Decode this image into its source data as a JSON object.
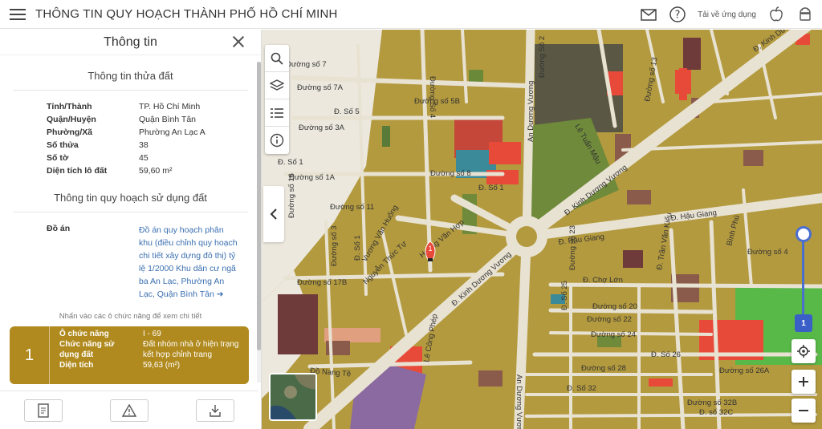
{
  "header": {
    "title": "THÔNG TIN QUY HOẠCH THÀNH PHỐ HỒ CHÍ MINH",
    "download_label": "Tải về ứng dụng"
  },
  "panel": {
    "title": "Thông tin",
    "parcel_section_title": "Thông tin thửa đất",
    "parcel": [
      {
        "key": "Tỉnh/Thành",
        "value": "TP. Hồ Chí Minh"
      },
      {
        "key": "Quận/Huyện",
        "value": "Quận Bình Tân"
      },
      {
        "key": "Phường/Xã",
        "value": "Phường An Lạc A"
      },
      {
        "key": "Số thửa",
        "value": "38"
      },
      {
        "key": "Số tờ",
        "value": "45"
      },
      {
        "key": "Diện tích lô đất",
        "value": "59,60 m²"
      }
    ],
    "plan_section_title": "Thông tin quy hoạch sử dụng đất",
    "plan_key": "Đồ án",
    "plan_link": "Đồ án quy hoạch phân khu (điều chỉnh quy hoạch chi tiết xây dựng đô thị) tỷ lệ 1/2000 Khu dân cư ngã ba An Lạc, Phường An Lạc, Quận Bình Tân ➔",
    "hint": "Nhấn vào các ô chức năng để xem chi tiết",
    "zone": {
      "number": "1",
      "rows": [
        {
          "key": "Ô chức năng",
          "value": "I - 69"
        },
        {
          "key": "Chức năng sử",
          "value": "Đất nhóm nhà ở hiện trạng"
        },
        {
          "key": "dụng đất",
          "value": "kết hợp chỉnh trang"
        },
        {
          "key": "Diện tích",
          "value": "59,63 (m²)"
        }
      ]
    }
  },
  "map": {
    "layer_badge": "1",
    "marker_number": "1",
    "streets": [
      "Đường số 7",
      "Đường số 7A",
      "Đ. Số 5",
      "Đường số 3A",
      "Đ. Số 1",
      "Đường số 1A",
      "Đường số 11",
      "Đường số 16",
      "Đường số 3",
      "Đường số 17B",
      "Đ. Số 1",
      "Đường số 5B",
      "Đường Số 4",
      "Đ. Số 1",
      "Nguyễn Thức Tự",
      "Vương Văn Huống",
      "Hoàng Văn Hợp",
      "Đ. Kinh Dương Vương",
      "An Dương Vương",
      "Lê Tuấn Mậu",
      "Đ. Kinh Dương Vương",
      "Đ. Hậu Giang",
      "Đ. Hậu Giang",
      "Đ. Chợ Lớn",
      "Đường số 20",
      "Đường số 22",
      "Đường số 24",
      "Đ. Số 26",
      "Đường số 28",
      "Đ. Số 32",
      "Đường số 26A",
      "Đ. Trần Văn Kiểu",
      "Bình Phú",
      "Đường số 4",
      "Đ. Kinh Dư",
      "Đồ Nang Tề",
      "Lê Công Phép",
      "An Dương Vương",
      "Đường số 23",
      "Đ. Số 25",
      "Đường số 32B",
      "Đ. số 32C",
      "Đường Số 2",
      "Đường số 13",
      "Đường số 8"
    ]
  },
  "colors": {
    "residential": "#b49a3e",
    "road": "#e8e2d2",
    "commercial": "#e84a3a",
    "green": "#6e8a3a",
    "park": "#58b848",
    "card": "#b08a1e",
    "link": "#3a6fb0"
  },
  "icons": [
    "hamburger-icon",
    "mail-icon",
    "help-icon",
    "apple-icon",
    "android-icon",
    "close-icon",
    "search-icon",
    "layers-icon",
    "legend-icon",
    "info-icon",
    "chevron-left-icon",
    "locate-icon",
    "plus-icon",
    "minus-icon",
    "map-pin-icon"
  ]
}
